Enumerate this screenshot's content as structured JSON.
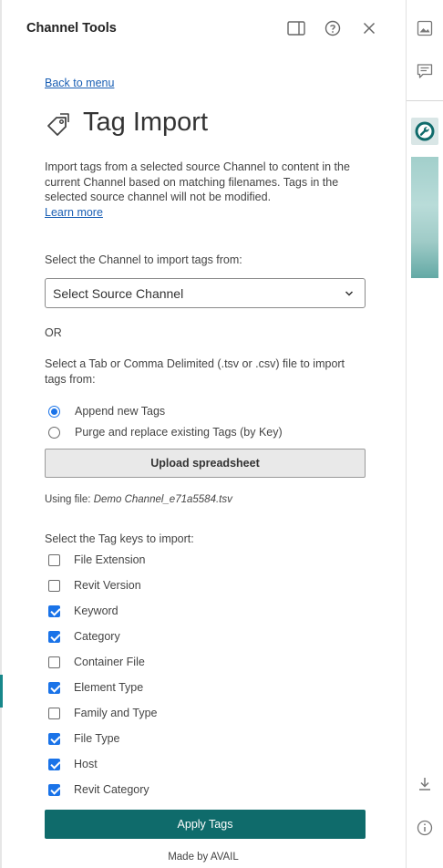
{
  "header": {
    "title": "Channel Tools",
    "icons": [
      "panel-toggle-icon",
      "help-icon",
      "close-icon"
    ]
  },
  "nav": {
    "back_label": "Back to menu"
  },
  "page": {
    "title": "Tag Import",
    "icon": "tag-icon",
    "description": "Import tags from a selected source Channel to content in the current Channel based on matching filenames. Tags in the selected source channel will not be modified.",
    "learn_more": "Learn more"
  },
  "source": {
    "label": "Select the Channel to import tags from:",
    "selected": "Select Source Channel"
  },
  "or_text": "OR",
  "file": {
    "label": "Select a Tab or Comma Delimited (.tsv or .csv) file to import tags from:",
    "modes": [
      {
        "label": "Append new Tags",
        "selected": true
      },
      {
        "label": "Purge and replace existing Tags (by Key)",
        "selected": false
      }
    ],
    "upload_label": "Upload spreadsheet",
    "using_prefix": "Using file:",
    "using_name": "Demo Channel_e71a5584.tsv"
  },
  "keys": {
    "label": "Select the Tag keys to import:",
    "items": [
      {
        "label": "File Extension",
        "checked": false
      },
      {
        "label": "Revit Version",
        "checked": false
      },
      {
        "label": "Keyword",
        "checked": true
      },
      {
        "label": "Category",
        "checked": true
      },
      {
        "label": "Container File",
        "checked": false
      },
      {
        "label": "Element Type",
        "checked": true
      },
      {
        "label": "Family and Type",
        "checked": false
      },
      {
        "label": "File Type",
        "checked": true
      },
      {
        "label": "Host",
        "checked": true
      },
      {
        "label": "Revit Category",
        "checked": true
      }
    ]
  },
  "actions": {
    "apply_label": "Apply Tags"
  },
  "footer": {
    "text": "Made by AVAIL"
  },
  "rail": {
    "icons": [
      "image-icon",
      "comment-icon",
      "wrench-icon",
      "download-icon",
      "info-icon"
    ]
  },
  "colors": {
    "accent": "#0f6b6b",
    "link": "#1a5fb4",
    "checkbox": "#1a73e8"
  }
}
